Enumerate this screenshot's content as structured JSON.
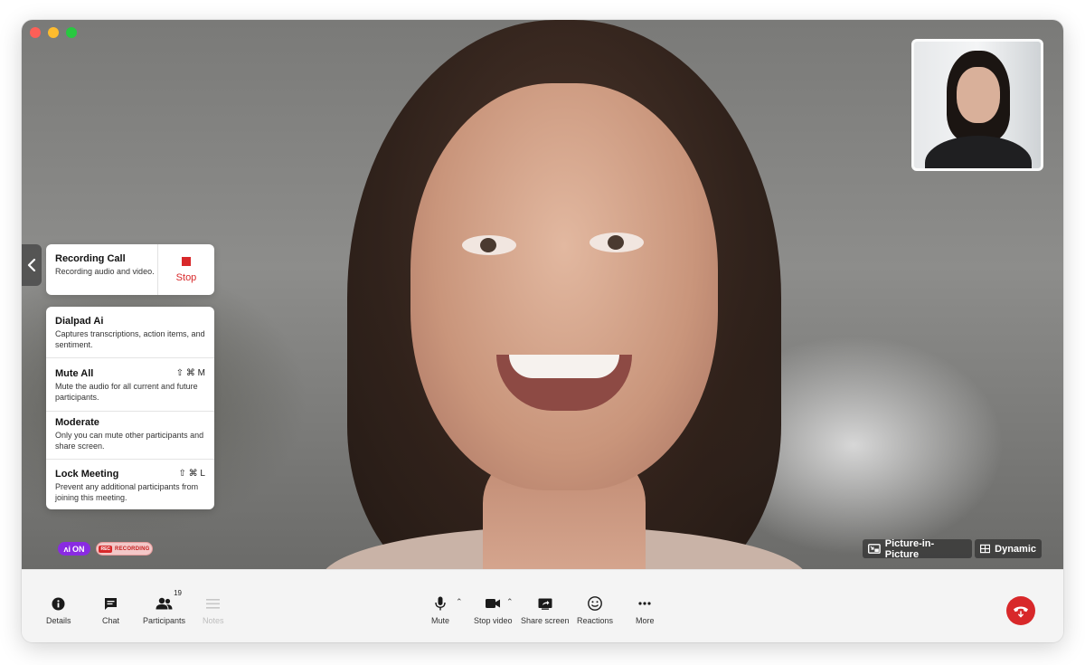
{
  "window": {
    "controls": [
      "close",
      "minimize",
      "zoom"
    ]
  },
  "recording_card": {
    "title": "Recording Call",
    "description": "Recording audio and video.",
    "stop_label": "Stop",
    "stop_icon": "stop-square-icon"
  },
  "menu": {
    "items": [
      {
        "title": "Dialpad Ai",
        "description": "Captures transcriptions, action items, and sentiment.",
        "shortcut": ""
      },
      {
        "title": "Mute All",
        "description": "Mute the audio for all current and future participants.",
        "shortcut": "⇧ ⌘ M"
      },
      {
        "title": "Moderate",
        "description": "Only you can mute other participants and share screen.",
        "shortcut": ""
      },
      {
        "title": "Lock Meeting",
        "description": "Prevent any additional participants from joining this meeting.",
        "shortcut": "⇧ ⌘ L"
      }
    ]
  },
  "status_badges": {
    "ai_mark": "ʌi",
    "ai_state": "ON",
    "rec_tag": "REC",
    "recording": "RECORDING"
  },
  "view_controls": {
    "pip_label": "Picture-in-Picture",
    "dynamic_label": "Dynamic"
  },
  "toolbar": {
    "left": [
      {
        "label": "Details",
        "icon": "info-icon"
      },
      {
        "label": "Chat",
        "icon": "chat-icon"
      },
      {
        "label": "Participants",
        "icon": "participants-icon",
        "count": "19"
      },
      {
        "label": "Notes",
        "icon": "notes-icon",
        "disabled": true
      }
    ],
    "center": [
      {
        "label": "Mute",
        "icon": "microphone-icon"
      },
      {
        "label": "Stop video",
        "icon": "video-camera-icon"
      },
      {
        "label": "Share screen",
        "icon": "share-screen-icon"
      },
      {
        "label": "Reactions",
        "icon": "smiley-icon"
      },
      {
        "label": "More",
        "icon": "more-dots-icon"
      }
    ],
    "caret": "⌃",
    "end_call_icon": "end-call-icon"
  },
  "colors": {
    "accent_red": "#d8282a",
    "ai_purple": "#8a2be2"
  }
}
